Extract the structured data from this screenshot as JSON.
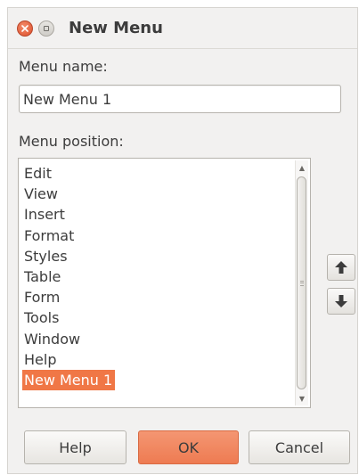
{
  "window": {
    "title": "New Menu"
  },
  "menu_name": {
    "label": "Menu name:",
    "value": "New Menu 1"
  },
  "menu_position": {
    "label": "Menu position:",
    "items": [
      "Edit",
      "View",
      "Insert",
      "Format",
      "Styles",
      "Table",
      "Form",
      "Tools",
      "Window",
      "Help",
      "New Menu 1"
    ],
    "selected_index": 10
  },
  "buttons": {
    "help": "Help",
    "ok": "OK",
    "cancel": "Cancel"
  },
  "colors": {
    "accent": "#f07746",
    "selection_text": "#ffffff"
  }
}
